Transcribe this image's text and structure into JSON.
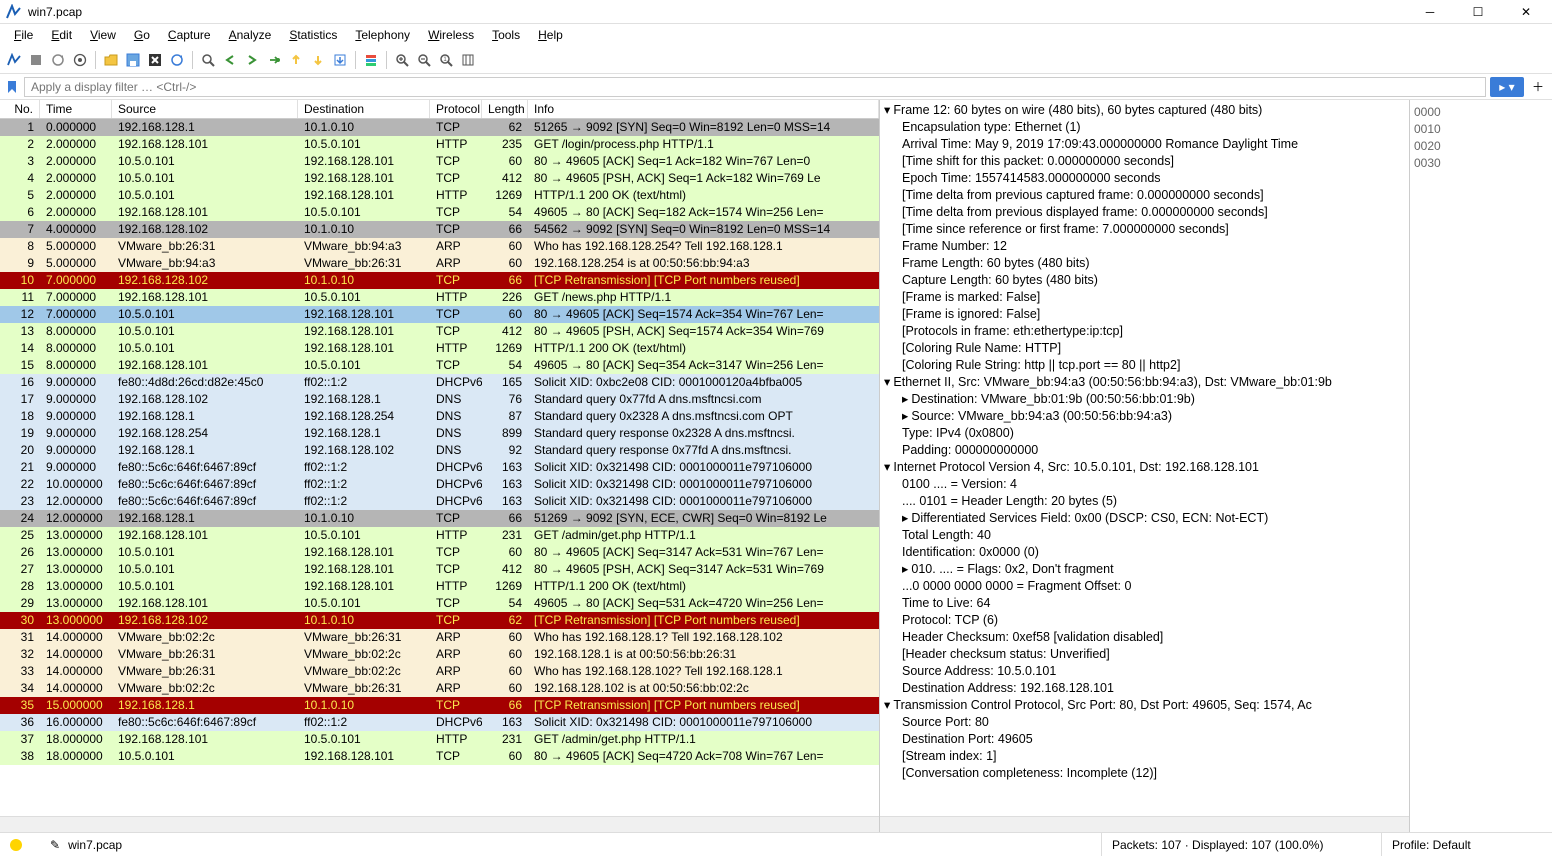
{
  "title": "win7.pcap",
  "menus": [
    "File",
    "Edit",
    "View",
    "Go",
    "Capture",
    "Analyze",
    "Statistics",
    "Telephony",
    "Wireless",
    "Tools",
    "Help"
  ],
  "filter_placeholder": "Apply a display filter … <Ctrl-/>",
  "columns": {
    "no": "No.",
    "time": "Time",
    "source": "Source",
    "dest": "Destination",
    "proto": "Protocol",
    "len": "Length",
    "info": "Info"
  },
  "packets": [
    {
      "n": 1,
      "t": "0.000000",
      "s": "192.168.128.1",
      "d": "10.1.0.10",
      "p": "TCP",
      "l": 62,
      "i": "51265 → 9092 [SYN] Seq=0 Win=8192 Len=0 MSS=14",
      "c": "grey"
    },
    {
      "n": 2,
      "t": "2.000000",
      "s": "192.168.128.101",
      "d": "10.5.0.101",
      "p": "HTTP",
      "l": 235,
      "i": "GET /login/process.php HTTP/1.1",
      "c": "green"
    },
    {
      "n": 3,
      "t": "2.000000",
      "s": "10.5.0.101",
      "d": "192.168.128.101",
      "p": "TCP",
      "l": 60,
      "i": "80 → 49605 [ACK] Seq=1 Ack=182 Win=767 Len=0",
      "c": "green"
    },
    {
      "n": 4,
      "t": "2.000000",
      "s": "10.5.0.101",
      "d": "192.168.128.101",
      "p": "TCP",
      "l": 412,
      "i": "80 → 49605 [PSH, ACK] Seq=1 Ack=182 Win=769 Le",
      "c": "green"
    },
    {
      "n": 5,
      "t": "2.000000",
      "s": "10.5.0.101",
      "d": "192.168.128.101",
      "p": "HTTP",
      "l": 1269,
      "i": "HTTP/1.1 200 OK  (text/html)",
      "c": "green"
    },
    {
      "n": 6,
      "t": "2.000000",
      "s": "192.168.128.101",
      "d": "10.5.0.101",
      "p": "TCP",
      "l": 54,
      "i": "49605 → 80 [ACK] Seq=182 Ack=1574 Win=256 Len=",
      "c": "green"
    },
    {
      "n": 7,
      "t": "4.000000",
      "s": "192.168.128.102",
      "d": "10.1.0.10",
      "p": "TCP",
      "l": 66,
      "i": "54562 → 9092 [SYN] Seq=0 Win=8192 Len=0 MSS=14",
      "c": "grey"
    },
    {
      "n": 8,
      "t": "5.000000",
      "s": "VMware_bb:26:31",
      "d": "VMware_bb:94:a3",
      "p": "ARP",
      "l": 60,
      "i": "Who has 192.168.128.254? Tell 192.168.128.1",
      "c": "cream"
    },
    {
      "n": 9,
      "t": "5.000000",
      "s": "VMware_bb:94:a3",
      "d": "VMware_bb:26:31",
      "p": "ARP",
      "l": 60,
      "i": "192.168.128.254 is at 00:50:56:bb:94:a3",
      "c": "cream"
    },
    {
      "n": 10,
      "t": "7.000000",
      "s": "192.168.128.102",
      "d": "10.1.0.10",
      "p": "TCP",
      "l": 66,
      "i": "[TCP Retransmission] [TCP Port numbers reused]",
      "c": "red"
    },
    {
      "n": 11,
      "t": "7.000000",
      "s": "192.168.128.101",
      "d": "10.5.0.101",
      "p": "HTTP",
      "l": 226,
      "i": "GET /news.php HTTP/1.1",
      "c": "green"
    },
    {
      "n": 12,
      "t": "7.000000",
      "s": "10.5.0.101",
      "d": "192.168.128.101",
      "p": "TCP",
      "l": 60,
      "i": "80 → 49605 [ACK] Seq=1574 Ack=354 Win=767 Len=",
      "c": "selected"
    },
    {
      "n": 13,
      "t": "8.000000",
      "s": "10.5.0.101",
      "d": "192.168.128.101",
      "p": "TCP",
      "l": 412,
      "i": "80 → 49605 [PSH, ACK] Seq=1574 Ack=354 Win=769",
      "c": "green"
    },
    {
      "n": 14,
      "t": "8.000000",
      "s": "10.5.0.101",
      "d": "192.168.128.101",
      "p": "HTTP",
      "l": 1269,
      "i": "HTTP/1.1 200 OK  (text/html)",
      "c": "green"
    },
    {
      "n": 15,
      "t": "8.000000",
      "s": "192.168.128.101",
      "d": "10.5.0.101",
      "p": "TCP",
      "l": 54,
      "i": "49605 → 80 [ACK] Seq=354 Ack=3147 Win=256 Len=",
      "c": "green"
    },
    {
      "n": 16,
      "t": "9.000000",
      "s": "fe80::4d8d:26cd:d82e:45c0",
      "d": "ff02::1:2",
      "p": "DHCPv6",
      "l": 165,
      "i": "Solicit XID: 0xbc2e08 CID: 0001000120a4bfba005",
      "c": "blue"
    },
    {
      "n": 17,
      "t": "9.000000",
      "s": "192.168.128.102",
      "d": "192.168.128.1",
      "p": "DNS",
      "l": 76,
      "i": "Standard query 0x77fd A dns.msftncsi.com",
      "c": "blue"
    },
    {
      "n": 18,
      "t": "9.000000",
      "s": "192.168.128.1",
      "d": "192.168.128.254",
      "p": "DNS",
      "l": 87,
      "i": "Standard query 0x2328 A dns.msftncsi.com OPT",
      "c": "blue"
    },
    {
      "n": 19,
      "t": "9.000000",
      "s": "192.168.128.254",
      "d": "192.168.128.1",
      "p": "DNS",
      "l": 899,
      "i": "Standard query response 0x2328 A dns.msftncsi.",
      "c": "blue"
    },
    {
      "n": 20,
      "t": "9.000000",
      "s": "192.168.128.1",
      "d": "192.168.128.102",
      "p": "DNS",
      "l": 92,
      "i": "Standard query response 0x77fd A dns.msftncsi.",
      "c": "blue"
    },
    {
      "n": 21,
      "t": "9.000000",
      "s": "fe80::5c6c:646f:6467:89cf",
      "d": "ff02::1:2",
      "p": "DHCPv6",
      "l": 163,
      "i": "Solicit XID: 0x321498 CID: 0001000011e797106000",
      "c": "blue"
    },
    {
      "n": 22,
      "t": "10.000000",
      "s": "fe80::5c6c:646f:6467:89cf",
      "d": "ff02::1:2",
      "p": "DHCPv6",
      "l": 163,
      "i": "Solicit XID: 0x321498 CID: 0001000011e797106000",
      "c": "blue"
    },
    {
      "n": 23,
      "t": "12.000000",
      "s": "fe80::5c6c:646f:6467:89cf",
      "d": "ff02::1:2",
      "p": "DHCPv6",
      "l": 163,
      "i": "Solicit XID: 0x321498 CID: 0001000011e797106000",
      "c": "blue"
    },
    {
      "n": 24,
      "t": "12.000000",
      "s": "192.168.128.1",
      "d": "10.1.0.10",
      "p": "TCP",
      "l": 66,
      "i": "51269 → 9092 [SYN, ECE, CWR] Seq=0 Win=8192 Le",
      "c": "grey"
    },
    {
      "n": 25,
      "t": "13.000000",
      "s": "192.168.128.101",
      "d": "10.5.0.101",
      "p": "HTTP",
      "l": 231,
      "i": "GET /admin/get.php HTTP/1.1",
      "c": "green"
    },
    {
      "n": 26,
      "t": "13.000000",
      "s": "10.5.0.101",
      "d": "192.168.128.101",
      "p": "TCP",
      "l": 60,
      "i": "80 → 49605 [ACK] Seq=3147 Ack=531 Win=767 Len=",
      "c": "green"
    },
    {
      "n": 27,
      "t": "13.000000",
      "s": "10.5.0.101",
      "d": "192.168.128.101",
      "p": "TCP",
      "l": 412,
      "i": "80 → 49605 [PSH, ACK] Seq=3147 Ack=531 Win=769",
      "c": "green"
    },
    {
      "n": 28,
      "t": "13.000000",
      "s": "10.5.0.101",
      "d": "192.168.128.101",
      "p": "HTTP",
      "l": 1269,
      "i": "HTTP/1.1 200 OK  (text/html)",
      "c": "green"
    },
    {
      "n": 29,
      "t": "13.000000",
      "s": "192.168.128.101",
      "d": "10.5.0.101",
      "p": "TCP",
      "l": 54,
      "i": "49605 → 80 [ACK] Seq=531 Ack=4720 Win=256 Len=",
      "c": "green"
    },
    {
      "n": 30,
      "t": "13.000000",
      "s": "192.168.128.102",
      "d": "10.1.0.10",
      "p": "TCP",
      "l": 62,
      "i": "[TCP Retransmission] [TCP Port numbers reused]",
      "c": "red"
    },
    {
      "n": 31,
      "t": "14.000000",
      "s": "VMware_bb:02:2c",
      "d": "VMware_bb:26:31",
      "p": "ARP",
      "l": 60,
      "i": "Who has 192.168.128.1? Tell 192.168.128.102",
      "c": "cream"
    },
    {
      "n": 32,
      "t": "14.000000",
      "s": "VMware_bb:26:31",
      "d": "VMware_bb:02:2c",
      "p": "ARP",
      "l": 60,
      "i": "192.168.128.1 is at 00:50:56:bb:26:31",
      "c": "cream"
    },
    {
      "n": 33,
      "t": "14.000000",
      "s": "VMware_bb:26:31",
      "d": "VMware_bb:02:2c",
      "p": "ARP",
      "l": 60,
      "i": "Who has 192.168.128.102? Tell 192.168.128.1",
      "c": "cream"
    },
    {
      "n": 34,
      "t": "14.000000",
      "s": "VMware_bb:02:2c",
      "d": "VMware_bb:26:31",
      "p": "ARP",
      "l": 60,
      "i": "192.168.128.102 is at 00:50:56:bb:02:2c",
      "c": "cream"
    },
    {
      "n": 35,
      "t": "15.000000",
      "s": "192.168.128.1",
      "d": "10.1.0.10",
      "p": "TCP",
      "l": 66,
      "i": "[TCP Retransmission] [TCP Port numbers reused]",
      "c": "red"
    },
    {
      "n": 36,
      "t": "16.000000",
      "s": "fe80::5c6c:646f:6467:89cf",
      "d": "ff02::1:2",
      "p": "DHCPv6",
      "l": 163,
      "i": "Solicit XID: 0x321498 CID: 0001000011e797106000",
      "c": "blue"
    },
    {
      "n": 37,
      "t": "18.000000",
      "s": "192.168.128.101",
      "d": "10.5.0.101",
      "p": "HTTP",
      "l": 231,
      "i": "GET /admin/get.php HTTP/1.1",
      "c": "green"
    },
    {
      "n": 38,
      "t": "18.000000",
      "s": "10.5.0.101",
      "d": "192.168.128.101",
      "p": "TCP",
      "l": 60,
      "i": "80 → 49605 [ACK] Seq=4720 Ack=708 Win=767 Len=",
      "c": "green"
    }
  ],
  "detail": [
    {
      "lvl": 0,
      "exp": "exp",
      "t": "Frame 12: 60 bytes on wire (480 bits), 60 bytes captured (480 bits)"
    },
    {
      "lvl": 1,
      "t": "Encapsulation type: Ethernet (1)"
    },
    {
      "lvl": 1,
      "t": "Arrival Time: May  9, 2019 17:09:43.000000000 Romance Daylight Time"
    },
    {
      "lvl": 1,
      "t": "[Time shift for this packet: 0.000000000 seconds]"
    },
    {
      "lvl": 1,
      "t": "Epoch Time: 1557414583.000000000 seconds"
    },
    {
      "lvl": 1,
      "t": "[Time delta from previous captured frame: 0.000000000 seconds]"
    },
    {
      "lvl": 1,
      "t": "[Time delta from previous displayed frame: 0.000000000 seconds]"
    },
    {
      "lvl": 1,
      "t": "[Time since reference or first frame: 7.000000000 seconds]"
    },
    {
      "lvl": 1,
      "t": "Frame Number: 12"
    },
    {
      "lvl": 1,
      "t": "Frame Length: 60 bytes (480 bits)"
    },
    {
      "lvl": 1,
      "t": "Capture Length: 60 bytes (480 bits)"
    },
    {
      "lvl": 1,
      "t": "[Frame is marked: False]"
    },
    {
      "lvl": 1,
      "t": "[Frame is ignored: False]"
    },
    {
      "lvl": 1,
      "t": "[Protocols in frame: eth:ethertype:ip:tcp]"
    },
    {
      "lvl": 1,
      "t": "[Coloring Rule Name: HTTP]"
    },
    {
      "lvl": 1,
      "t": "[Coloring Rule String: http || tcp.port == 80 || http2]"
    },
    {
      "lvl": 0,
      "exp": "exp",
      "t": "Ethernet II, Src: VMware_bb:94:a3 (00:50:56:bb:94:a3), Dst: VMware_bb:01:9b"
    },
    {
      "lvl": 1,
      "exp": "col",
      "t": "Destination: VMware_bb:01:9b (00:50:56:bb:01:9b)"
    },
    {
      "lvl": 1,
      "exp": "col",
      "t": "Source: VMware_bb:94:a3 (00:50:56:bb:94:a3)"
    },
    {
      "lvl": 1,
      "t": "Type: IPv4 (0x0800)"
    },
    {
      "lvl": 1,
      "t": "Padding: 000000000000"
    },
    {
      "lvl": 0,
      "exp": "exp",
      "t": "Internet Protocol Version 4, Src: 10.5.0.101, Dst: 192.168.128.101"
    },
    {
      "lvl": 1,
      "t": "0100 .... = Version: 4"
    },
    {
      "lvl": 1,
      "t": ".... 0101 = Header Length: 20 bytes (5)"
    },
    {
      "lvl": 1,
      "exp": "col",
      "t": "Differentiated Services Field: 0x00 (DSCP: CS0, ECN: Not-ECT)"
    },
    {
      "lvl": 1,
      "t": "Total Length: 40"
    },
    {
      "lvl": 1,
      "t": "Identification: 0x0000 (0)"
    },
    {
      "lvl": 1,
      "exp": "col",
      "t": "010. .... = Flags: 0x2, Don't fragment"
    },
    {
      "lvl": 1,
      "t": "...0 0000 0000 0000 = Fragment Offset: 0"
    },
    {
      "lvl": 1,
      "t": "Time to Live: 64"
    },
    {
      "lvl": 1,
      "t": "Protocol: TCP (6)"
    },
    {
      "lvl": 1,
      "t": "Header Checksum: 0xef58 [validation disabled]"
    },
    {
      "lvl": 1,
      "t": "[Header checksum status: Unverified]"
    },
    {
      "lvl": 1,
      "t": "Source Address: 10.5.0.101"
    },
    {
      "lvl": 1,
      "t": "Destination Address: 192.168.128.101"
    },
    {
      "lvl": 0,
      "exp": "exp",
      "t": "Transmission Control Protocol, Src Port: 80, Dst Port: 49605, Seq: 1574, Ac"
    },
    {
      "lvl": 1,
      "t": "Source Port: 80"
    },
    {
      "lvl": 1,
      "t": "Destination Port: 49605"
    },
    {
      "lvl": 1,
      "t": "[Stream index: 1]"
    },
    {
      "lvl": 1,
      "t": "[Conversation completeness: Incomplete (12)]"
    }
  ],
  "hex_offsets": [
    "0000",
    "0010",
    "0020",
    "0030"
  ],
  "status": {
    "file": "win7.pcap",
    "packets": "Packets: 107 · Displayed: 107 (100.0%)",
    "profile": "Profile: Default"
  }
}
